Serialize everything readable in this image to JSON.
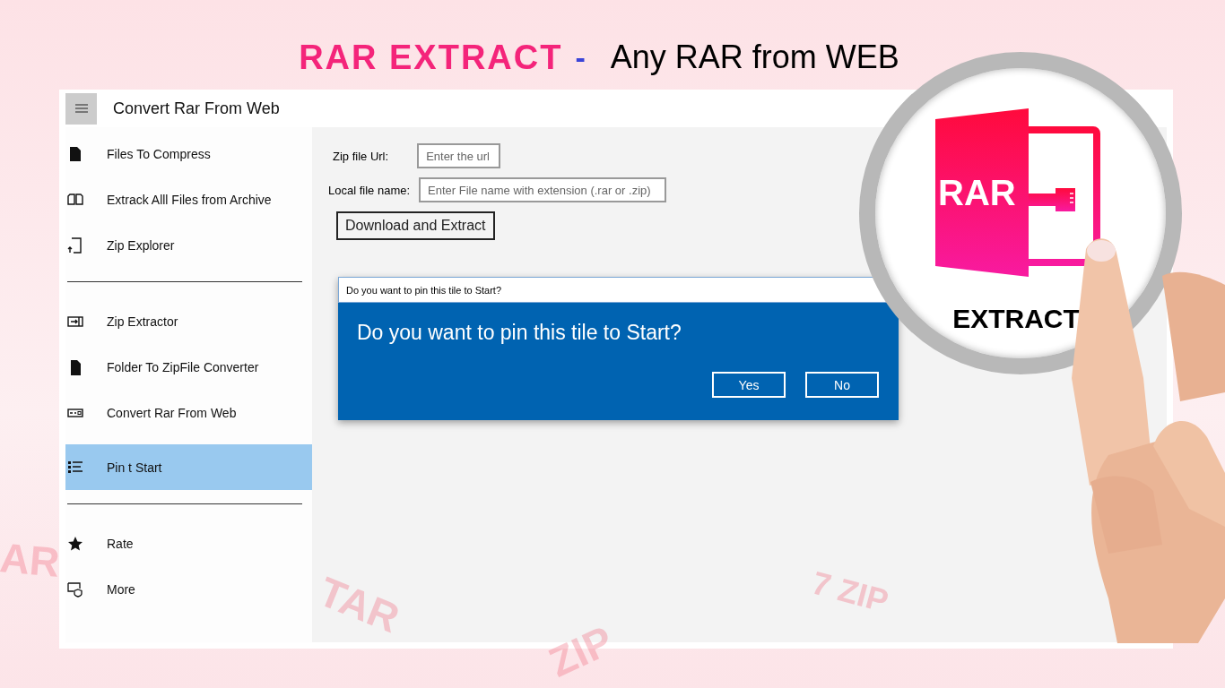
{
  "banner": {
    "title_part1": "RAR EXTRACT",
    "separator": "-",
    "title_part2": "Any RAR from WEB"
  },
  "background_words": [
    {
      "text": "AR"
    },
    {
      "text": "TAR"
    },
    {
      "text": "ZIP"
    },
    {
      "text": "7 ZIP"
    }
  ],
  "app": {
    "title": "Convert Rar From Web",
    "menu_items": [
      {
        "kind": "item",
        "label": "Files To Compress",
        "selected": false
      },
      {
        "kind": "item",
        "label": "Extrack Alll Files from  Archive",
        "selected": false
      },
      {
        "kind": "item",
        "label": "Zip Explorer",
        "selected": false
      },
      {
        "kind": "divider"
      },
      {
        "kind": "item",
        "label": "Zip Extractor",
        "selected": false
      },
      {
        "kind": "item",
        "label": "Folder To ZipFile Converter",
        "selected": false
      },
      {
        "kind": "item",
        "label": "Convert Rar From Web",
        "selected": false
      },
      {
        "kind": "item",
        "label": "Pin t Start",
        "selected": true
      },
      {
        "kind": "divider"
      },
      {
        "kind": "item",
        "label": "Rate",
        "selected": false
      },
      {
        "kind": "item",
        "label": "More",
        "selected": false
      }
    ],
    "form": {
      "fields": [
        {
          "label": "Zip file Url:",
          "placeholder": "Enter the url"
        },
        {
          "label": "Local file name:",
          "placeholder": "Enter File name with extension (.rar or .zip)"
        }
      ],
      "button": "Download and Extract"
    },
    "dialog": {
      "window_title": "Do you want to pin this tile to Start?",
      "message": "Do you want to pin this tile to Start?",
      "buttons": [
        "Yes",
        "No"
      ]
    }
  },
  "logo": {
    "badge": "RAR",
    "caption": "EXTRACT"
  }
}
